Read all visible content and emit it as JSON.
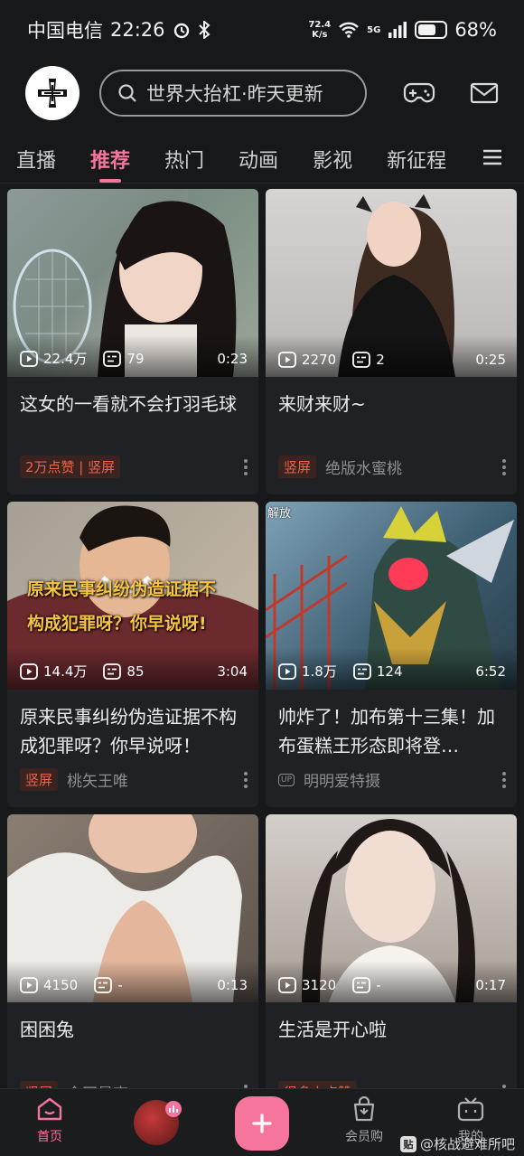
{
  "status_bar": {
    "carrier": "中国电信",
    "time": "22:26",
    "net_speed_value": "72.4",
    "net_speed_unit": "K/s",
    "network": "5G",
    "battery": "68%"
  },
  "header": {
    "search_placeholder": "世界大抬杠·昨天更新"
  },
  "tabs": [
    {
      "label": "直播"
    },
    {
      "label": "推荐"
    },
    {
      "label": "热门"
    },
    {
      "label": "动画"
    },
    {
      "label": "影视"
    },
    {
      "label": "新征程"
    }
  ],
  "cards": [
    {
      "views": "22.4万",
      "danmaku": "79",
      "duration": "0:23",
      "title": "这女的一看就不会打羽毛球",
      "tag": "2万点赞 | 竖屏",
      "author": "",
      "palette": [
        "#8d9a99",
        "#c7c2bb"
      ]
    },
    {
      "views": "2270",
      "danmaku": "2",
      "duration": "0:25",
      "title": "来财来财~",
      "tag": "竖屏",
      "author": "绝版水蜜桃",
      "palette": [
        "#cfcdcc",
        "#a8a6a5"
      ]
    },
    {
      "views": "14.4万",
      "danmaku": "85",
      "duration": "3:04",
      "title": "原来民事纠纷伪造证据不构成犯罪呀？你早说呀！",
      "tag": "竖屏",
      "author": "桃矢王唯",
      "caption_line1": "原来民事纠纷伪造证据不",
      "caption_line2": "构成犯罪呀？你早说呀!",
      "palette": [
        "#6b2a2e",
        "#c7b9a6"
      ]
    },
    {
      "views": "1.8万",
      "danmaku": "124",
      "duration": "6:52",
      "title": "帅炸了！加布第十三集！加布蛋糕王形态即将登…",
      "tag": "",
      "author": "明明爱特摄",
      "up_badge": "UP",
      "corner": "解放",
      "palette": [
        "#3a5a6d",
        "#b53a3a"
      ]
    },
    {
      "views": "4150",
      "danmaku": "-",
      "duration": "0:13",
      "title": "困困兔",
      "tag": "竖屏",
      "author": "全网最齐",
      "palette": [
        "#8b7e73",
        "#e8e3dc"
      ]
    },
    {
      "views": "3120",
      "danmaku": "-",
      "duration": "0:17",
      "title": "生活是开心啦",
      "tag": "很多人点赞",
      "author": "",
      "palette": [
        "#cfcac4",
        "#a99e95"
      ]
    }
  ],
  "bottom_nav": {
    "home": "首页",
    "member": "会员购",
    "mine": "我的"
  },
  "watermark": "@核战避难所吧"
}
